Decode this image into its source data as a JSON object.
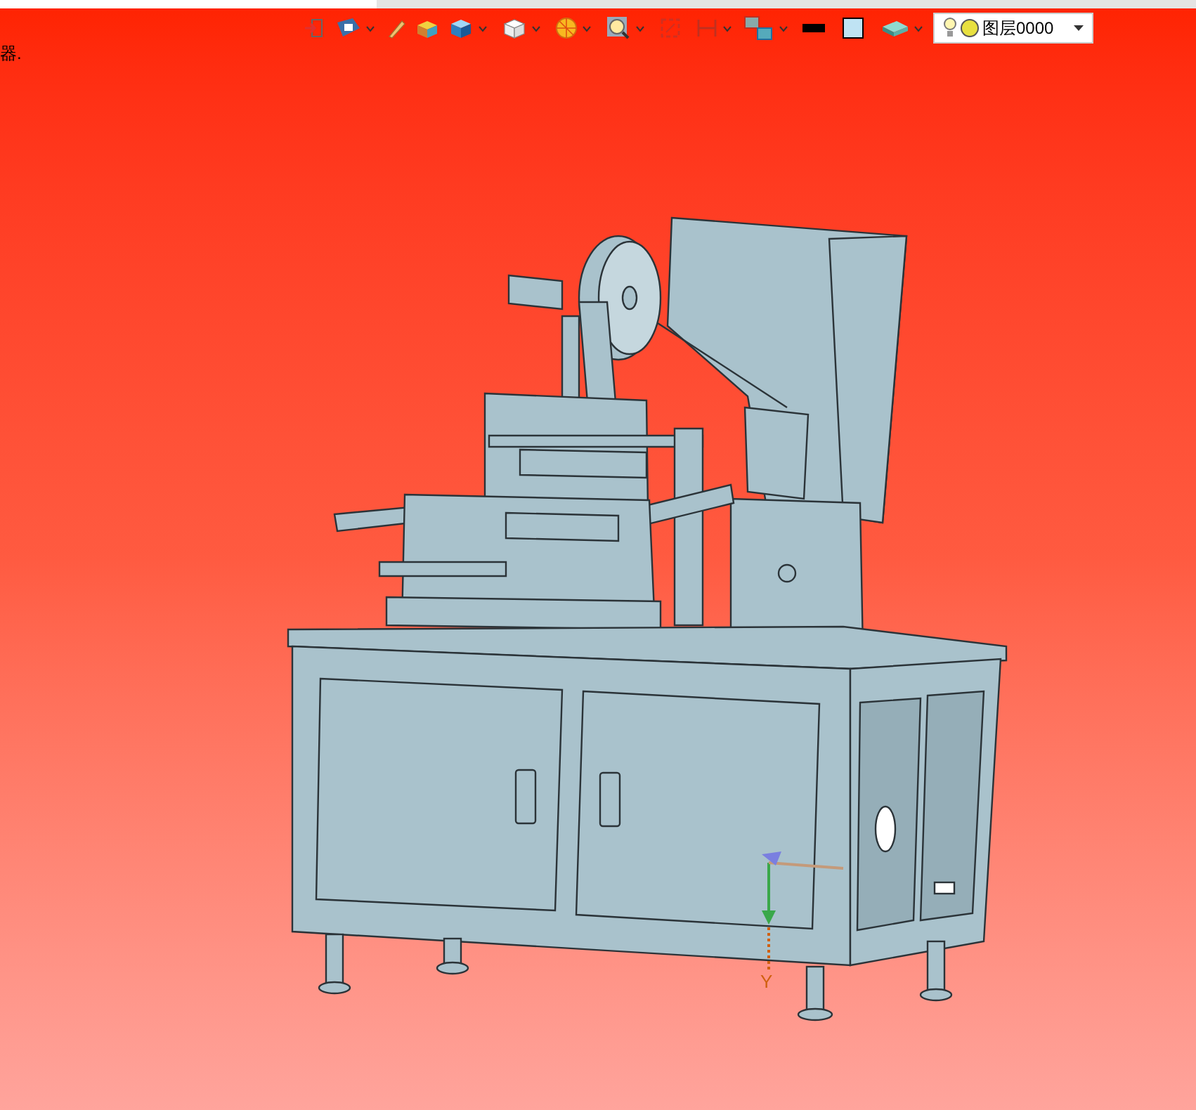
{
  "side_text": "器.",
  "layer_select": {
    "value": "图层0000"
  },
  "axis_label": "Y"
}
